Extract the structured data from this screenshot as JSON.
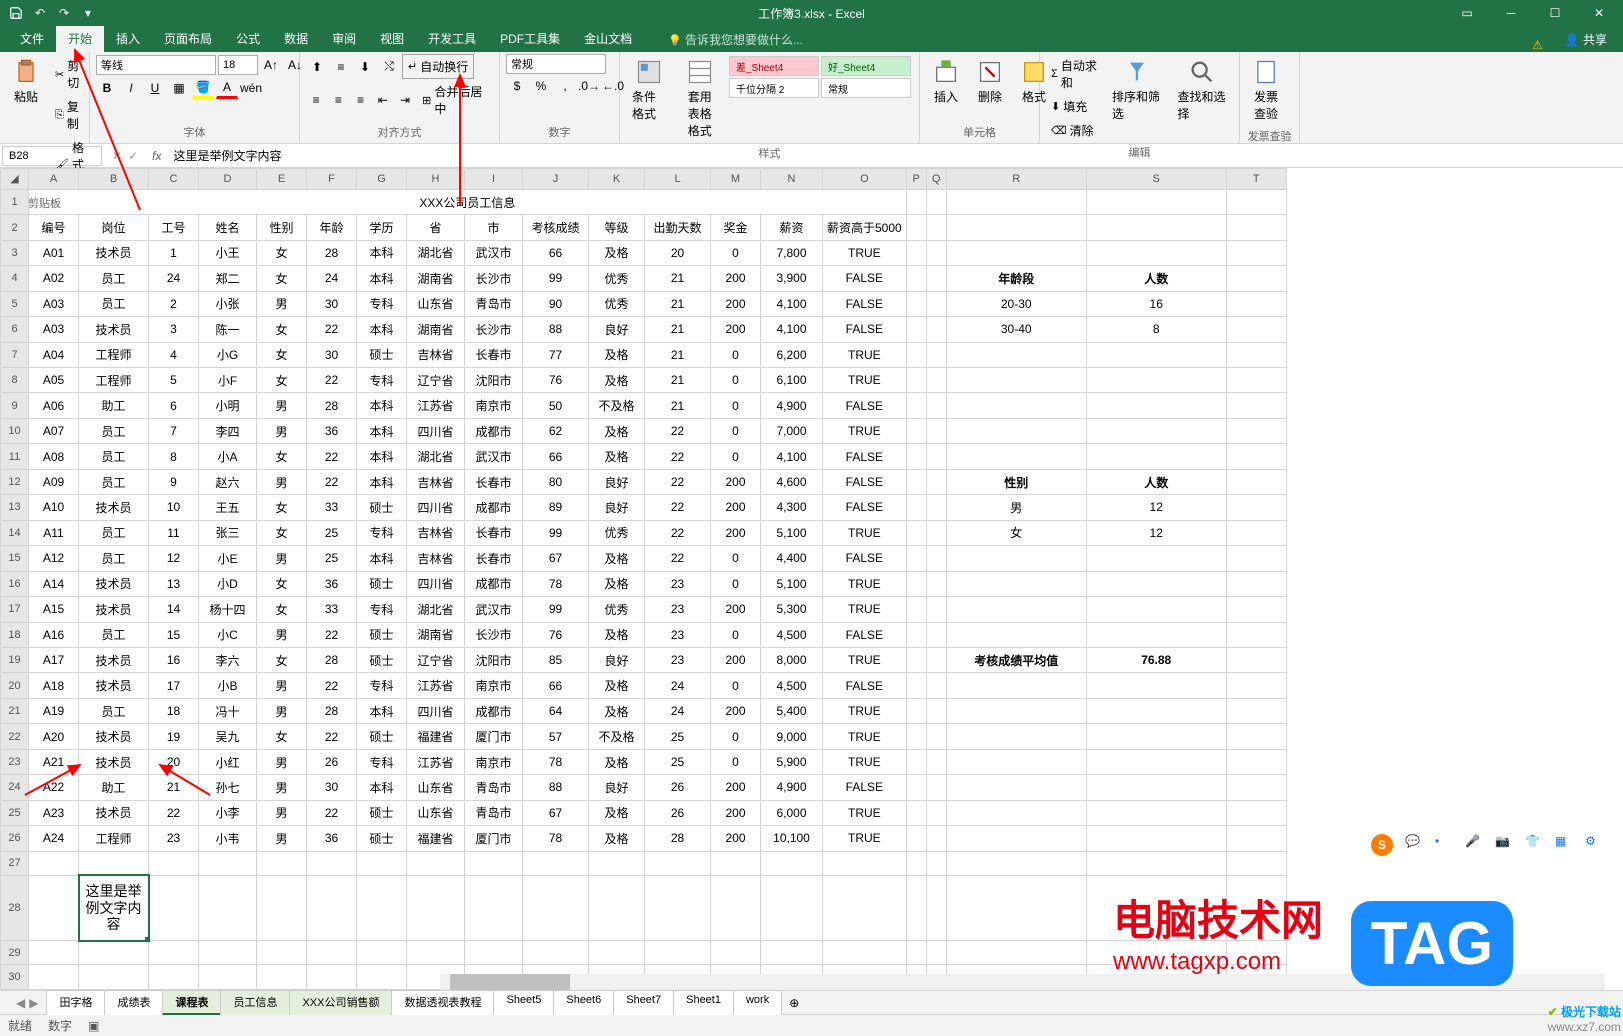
{
  "titlebar": {
    "filename": "工作簿3.xlsx - Excel",
    "share": "共享"
  },
  "menu": {
    "file": "文件",
    "home": "开始",
    "insert": "插入",
    "layout": "页面布局",
    "formula": "公式",
    "data": "数据",
    "review": "审阅",
    "view": "视图",
    "dev": "开发工具",
    "pdf": "PDF工具集",
    "wps": "金山文档",
    "tellme": "告诉我您想要做什么..."
  },
  "ribbon": {
    "clipboard": {
      "label": "剪贴板",
      "paste": "粘贴",
      "cut": "剪切",
      "copy": "复制",
      "brush": "格式刷"
    },
    "font": {
      "label": "字体",
      "name": "等线",
      "size": "18"
    },
    "align": {
      "label": "对齐方式",
      "wrap": "自动换行",
      "merge": "合并后居中"
    },
    "number": {
      "label": "数字",
      "format": "常规"
    },
    "styles": {
      "label": "样式",
      "cond": "条件格式",
      "table": "套用\n表格格式",
      "bad": "差_Sheet4",
      "good": "好_Sheet4",
      "thousand": "千位分隔 2",
      "normal": "常规"
    },
    "cells": {
      "label": "单元格",
      "insert": "插入",
      "delete": "删除",
      "format": "格式"
    },
    "editing": {
      "label": "编辑",
      "sum": "自动求和",
      "fill": "填充",
      "clear": "清除",
      "sort": "排序和筛选",
      "find": "查找和选择"
    },
    "invoice": {
      "label": "发票查验",
      "check": "发票\n查验"
    }
  },
  "namebox": "B28",
  "formula": "这里是举例文字内容",
  "columns": [
    "A",
    "B",
    "C",
    "D",
    "E",
    "F",
    "G",
    "H",
    "I",
    "J",
    "K",
    "L",
    "M",
    "N",
    "O",
    "P",
    "Q",
    "R",
    "S",
    "T"
  ],
  "title_row": "XXX公司员工信息",
  "headers": [
    "编号",
    "岗位",
    "工号",
    "姓名",
    "性别",
    "年龄",
    "学历",
    "省",
    "市",
    "考核成绩",
    "等级",
    "出勤天数",
    "奖金",
    "薪资",
    "薪资高于5000"
  ],
  "rows": [
    [
      "A01",
      "技术员",
      "1",
      "小王",
      "女",
      "28",
      "本科",
      "湖北省",
      "武汉市",
      "66",
      "及格",
      "20",
      "0",
      "7,800",
      "TRUE"
    ],
    [
      "A02",
      "员工",
      "24",
      "郑二",
      "女",
      "24",
      "本科",
      "湖南省",
      "长沙市",
      "99",
      "优秀",
      "21",
      "200",
      "3,900",
      "FALSE"
    ],
    [
      "A03",
      "员工",
      "2",
      "小张",
      "男",
      "30",
      "专科",
      "山东省",
      "青岛市",
      "90",
      "优秀",
      "21",
      "200",
      "4,100",
      "FALSE"
    ],
    [
      "A03",
      "技术员",
      "3",
      "陈一",
      "女",
      "22",
      "本科",
      "湖南省",
      "长沙市",
      "88",
      "良好",
      "21",
      "200",
      "4,100",
      "FALSE"
    ],
    [
      "A04",
      "工程师",
      "4",
      "小G",
      "女",
      "30",
      "硕士",
      "吉林省",
      "长春市",
      "77",
      "及格",
      "21",
      "0",
      "6,200",
      "TRUE"
    ],
    [
      "A05",
      "工程师",
      "5",
      "小F",
      "女",
      "22",
      "专科",
      "辽宁省",
      "沈阳市",
      "76",
      "及格",
      "21",
      "0",
      "6,100",
      "TRUE"
    ],
    [
      "A06",
      "助工",
      "6",
      "小明",
      "男",
      "28",
      "本科",
      "江苏省",
      "南京市",
      "50",
      "不及格",
      "21",
      "0",
      "4,900",
      "FALSE"
    ],
    [
      "A07",
      "员工",
      "7",
      "李四",
      "男",
      "36",
      "本科",
      "四川省",
      "成都市",
      "62",
      "及格",
      "22",
      "0",
      "7,000",
      "TRUE"
    ],
    [
      "A08",
      "员工",
      "8",
      "小A",
      "女",
      "22",
      "本科",
      "湖北省",
      "武汉市",
      "66",
      "及格",
      "22",
      "0",
      "4,100",
      "FALSE"
    ],
    [
      "A09",
      "员工",
      "9",
      "赵六",
      "男",
      "22",
      "本科",
      "吉林省",
      "长春市",
      "80",
      "良好",
      "22",
      "200",
      "4,600",
      "FALSE"
    ],
    [
      "A10",
      "技术员",
      "10",
      "王五",
      "女",
      "33",
      "硕士",
      "四川省",
      "成都市",
      "89",
      "良好",
      "22",
      "200",
      "4,300",
      "FALSE"
    ],
    [
      "A11",
      "员工",
      "11",
      "张三",
      "女",
      "25",
      "专科",
      "吉林省",
      "长春市",
      "99",
      "优秀",
      "22",
      "200",
      "5,100",
      "TRUE"
    ],
    [
      "A12",
      "员工",
      "12",
      "小E",
      "男",
      "25",
      "本科",
      "吉林省",
      "长春市",
      "67",
      "及格",
      "22",
      "0",
      "4,400",
      "FALSE"
    ],
    [
      "A14",
      "技术员",
      "13",
      "小D",
      "女",
      "36",
      "硕士",
      "四川省",
      "成都市",
      "78",
      "及格",
      "23",
      "0",
      "5,100",
      "TRUE"
    ],
    [
      "A15",
      "技术员",
      "14",
      "杨十四",
      "女",
      "33",
      "专科",
      "湖北省",
      "武汉市",
      "99",
      "优秀",
      "23",
      "200",
      "5,300",
      "TRUE"
    ],
    [
      "A16",
      "员工",
      "15",
      "小C",
      "男",
      "22",
      "硕士",
      "湖南省",
      "长沙市",
      "76",
      "及格",
      "23",
      "0",
      "4,500",
      "FALSE"
    ],
    [
      "A17",
      "技术员",
      "16",
      "李六",
      "女",
      "28",
      "硕士",
      "辽宁省",
      "沈阳市",
      "85",
      "良好",
      "23",
      "200",
      "8,000",
      "TRUE"
    ],
    [
      "A18",
      "技术员",
      "17",
      "小B",
      "男",
      "22",
      "专科",
      "江苏省",
      "南京市",
      "66",
      "及格",
      "24",
      "0",
      "4,500",
      "FALSE"
    ],
    [
      "A19",
      "员工",
      "18",
      "冯十",
      "男",
      "28",
      "本科",
      "四川省",
      "成都市",
      "64",
      "及格",
      "24",
      "200",
      "5,400",
      "TRUE"
    ],
    [
      "A20",
      "技术员",
      "19",
      "吴九",
      "女",
      "22",
      "硕士",
      "福建省",
      "厦门市",
      "57",
      "不及格",
      "25",
      "0",
      "9,000",
      "TRUE"
    ],
    [
      "A21",
      "技术员",
      "20",
      "小红",
      "男",
      "26",
      "专科",
      "江苏省",
      "南京市",
      "78",
      "及格",
      "25",
      "0",
      "5,900",
      "TRUE"
    ],
    [
      "A22",
      "助工",
      "21",
      "孙七",
      "男",
      "30",
      "本科",
      "山东省",
      "青岛市",
      "88",
      "良好",
      "26",
      "200",
      "4,900",
      "FALSE"
    ],
    [
      "A23",
      "技术员",
      "22",
      "小李",
      "男",
      "22",
      "硕士",
      "山东省",
      "青岛市",
      "67",
      "及格",
      "26",
      "200",
      "6,000",
      "TRUE"
    ],
    [
      "A24",
      "工程师",
      "23",
      "小韦",
      "男",
      "36",
      "硕士",
      "福建省",
      "厦门市",
      "78",
      "及格",
      "28",
      "200",
      "10,100",
      "TRUE"
    ]
  ],
  "selected_cell_text": "这里是举例文字内容",
  "side_tables": {
    "age": {
      "header1": "年龄段",
      "header2": "人数",
      "r1c1": "20-30",
      "r1c2": "16",
      "r2c1": "30-40",
      "r2c2": "8"
    },
    "gender": {
      "header1": "性别",
      "header2": "人数",
      "r1c1": "男",
      "r1c2": "12",
      "r2c1": "女",
      "r2c2": "12"
    },
    "avg": {
      "label": "考核成绩平均值",
      "value": "76.88"
    }
  },
  "sheets": [
    "田字格",
    "成绩表",
    "课程表",
    "员工信息",
    "XXX公司销售额",
    "数据透视表教程",
    "Sheet5",
    "Sheet6",
    "Sheet7",
    "Sheet1",
    "work"
  ],
  "active_sheet": 2,
  "status": {
    "ready": "就绪",
    "calc": "数字"
  },
  "watermark": {
    "t1": "电脑技术网",
    "url": "www.tagxp.com",
    "tag": "TAG",
    "corner1": "极光下载站",
    "corner2": "www.xz7.com"
  }
}
